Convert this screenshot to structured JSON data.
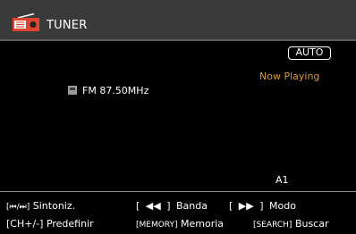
{
  "header": {
    "title": "TUNER",
    "icon": "radio-icon",
    "accent_color": "#e0442f"
  },
  "status": {
    "mode_badge": "AUTO",
    "now_playing": "Now Playing",
    "now_playing_color": "#d99a2e"
  },
  "station": {
    "band_icon": "radio-band-icon",
    "frequency": "FM 87.50MHz"
  },
  "preset": {
    "label": "A1"
  },
  "footer": {
    "hints": [
      {
        "key": "[⏮/⏭]",
        "label": "Sintoniz."
      },
      {
        "key": "[ ◀◀ ]",
        "label": "Banda"
      },
      {
        "key": "[ ▶▶ ]",
        "label": "Modo"
      },
      {
        "key": "[CH+/-]",
        "label": "Predefinir"
      },
      {
        "key": "[MEMORY]",
        "label": "Memoria"
      },
      {
        "key": "[SEARCH]",
        "label": "Buscar"
      }
    ]
  }
}
